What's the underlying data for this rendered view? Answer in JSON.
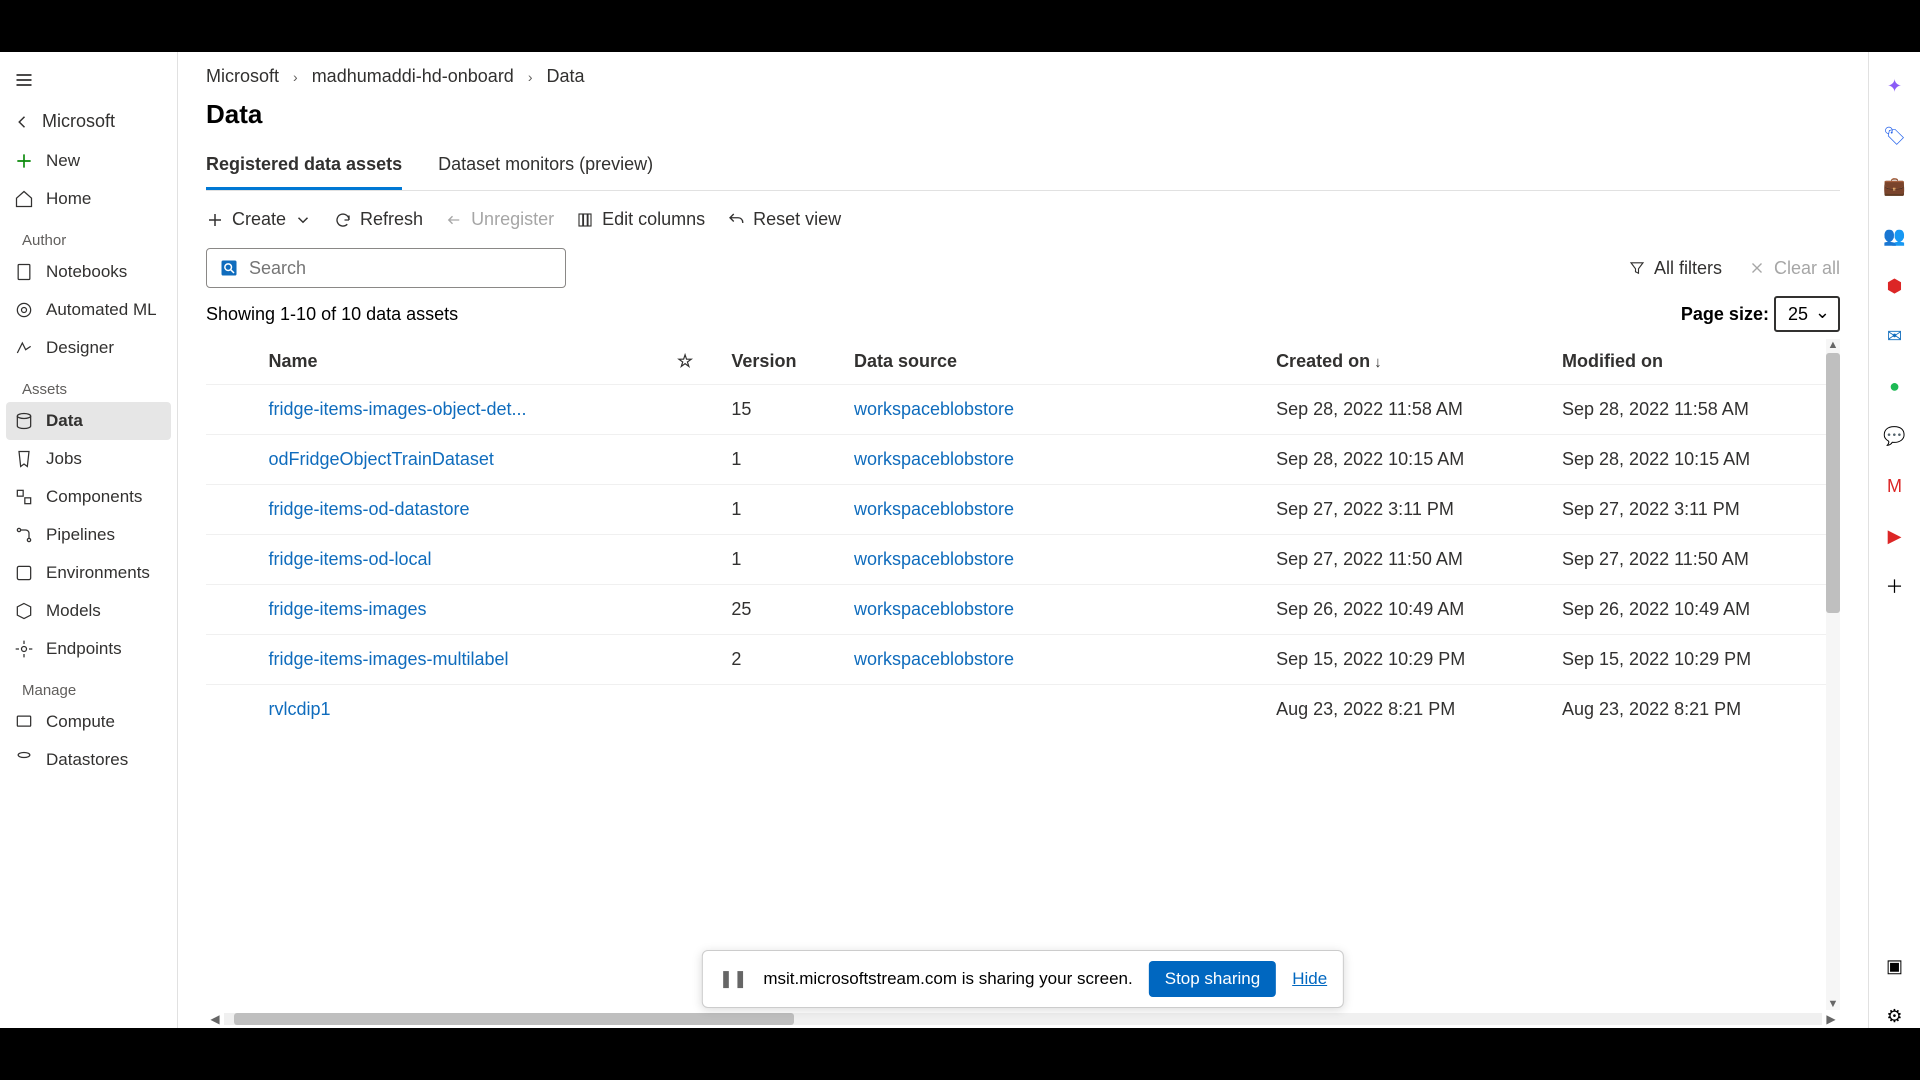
{
  "workspace": "Microsoft",
  "sidebar": {
    "new": "New",
    "home": "Home",
    "groups": {
      "author": "Author",
      "assets": "Assets",
      "manage": "Manage"
    },
    "items": {
      "notebooks": "Notebooks",
      "automl": "Automated ML",
      "designer": "Designer",
      "data": "Data",
      "jobs": "Jobs",
      "components": "Components",
      "pipelines": "Pipelines",
      "environments": "Environments",
      "models": "Models",
      "endpoints": "Endpoints",
      "compute": "Compute",
      "datastores": "Datastores"
    }
  },
  "breadcrumb": [
    "Microsoft",
    "madhumaddi-hd-onboard",
    "Data"
  ],
  "page_title": "Data",
  "tabs": {
    "registered": "Registered data assets",
    "monitors": "Dataset monitors (preview)"
  },
  "toolbar": {
    "create": "Create",
    "refresh": "Refresh",
    "unregister": "Unregister",
    "edit_columns": "Edit columns",
    "reset_view": "Reset view"
  },
  "search": {
    "placeholder": "Search"
  },
  "filters": {
    "all": "All filters",
    "clear": "Clear all"
  },
  "count_text": "Showing 1-10 of 10 data assets",
  "page_size_label": "Page size:",
  "page_size_value": "25",
  "columns": {
    "name": "Name",
    "version": "Version",
    "data_source": "Data source",
    "created": "Created on",
    "modified": "Modified on"
  },
  "rows": [
    {
      "name": "fridge-items-images-object-det...",
      "version": "15",
      "ds": "workspaceblobstore",
      "created": "Sep 28, 2022 11:58 AM",
      "modified": "Sep 28, 2022 11:58 AM"
    },
    {
      "name": "odFridgeObjectTrainDataset",
      "version": "1",
      "ds": "workspaceblobstore",
      "created": "Sep 28, 2022 10:15 AM",
      "modified": "Sep 28, 2022 10:15 AM"
    },
    {
      "name": "fridge-items-od-datastore",
      "version": "1",
      "ds": "workspaceblobstore",
      "created": "Sep 27, 2022 3:11 PM",
      "modified": "Sep 27, 2022 3:11 PM"
    },
    {
      "name": "fridge-items-od-local",
      "version": "1",
      "ds": "workspaceblobstore",
      "created": "Sep 27, 2022 11:50 AM",
      "modified": "Sep 27, 2022 11:50 AM"
    },
    {
      "name": "fridge-items-images",
      "version": "25",
      "ds": "workspaceblobstore",
      "created": "Sep 26, 2022 10:49 AM",
      "modified": "Sep 26, 2022 10:49 AM"
    },
    {
      "name": "fridge-items-images-multilabel",
      "version": "2",
      "ds": "workspaceblobstore",
      "created": "Sep 15, 2022 10:29 PM",
      "modified": "Sep 15, 2022 10:29 PM"
    },
    {
      "name": "rvlcdip1",
      "version": "",
      "ds": "",
      "created": "Aug 23, 2022 8:21 PM",
      "modified": "Aug 23, 2022 8:21 PM"
    }
  ],
  "share_bar": {
    "text": "msit.microsoftstream.com is sharing your screen.",
    "stop": "Stop sharing",
    "hide": "Hide"
  }
}
